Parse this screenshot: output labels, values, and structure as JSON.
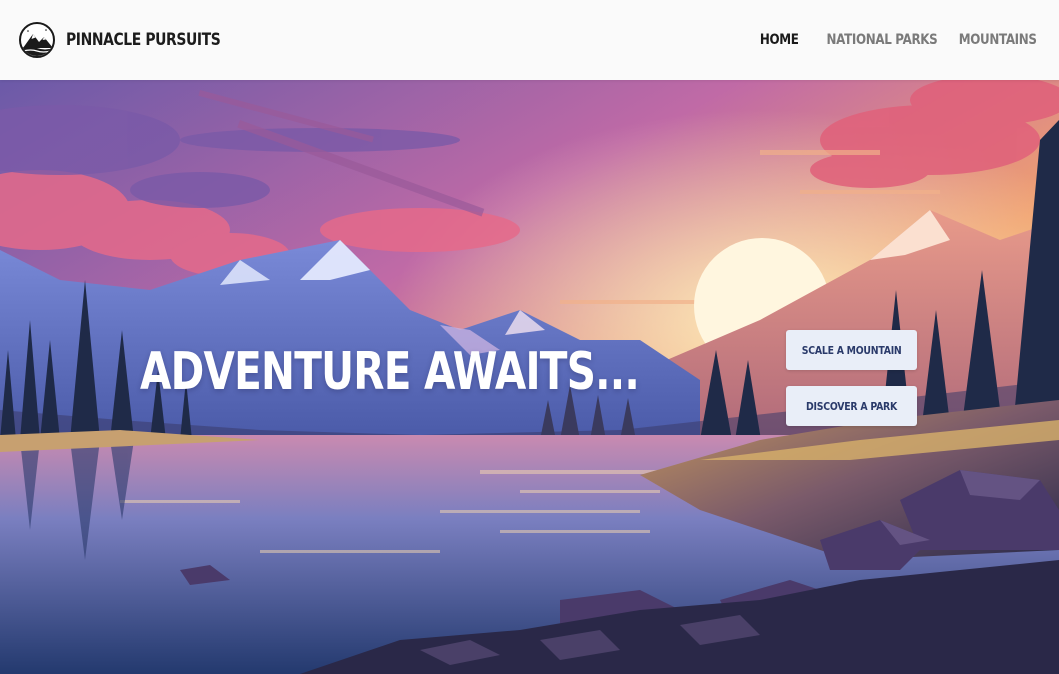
{
  "brand": {
    "name": "PINNACLE PURSUITS",
    "logo_icon": "mountain-logo-icon"
  },
  "nav": {
    "items": [
      {
        "label": "HOME",
        "active": true
      },
      {
        "label": "NATIONAL PARKS",
        "active": false
      },
      {
        "label": "MOUNTAINS",
        "active": false
      }
    ]
  },
  "hero": {
    "title": "ADVENTURE AWAITS...",
    "buttons": [
      {
        "label": "SCALE A MOUNTAIN"
      },
      {
        "label": "DISCOVER A PARK"
      }
    ]
  },
  "colors": {
    "header_bg": "#fafafa",
    "nav_active": "#1a1a1a",
    "nav_inactive": "#7a7a7a",
    "button_bg": "#e9eef8",
    "button_text": "#2a3a6a"
  }
}
